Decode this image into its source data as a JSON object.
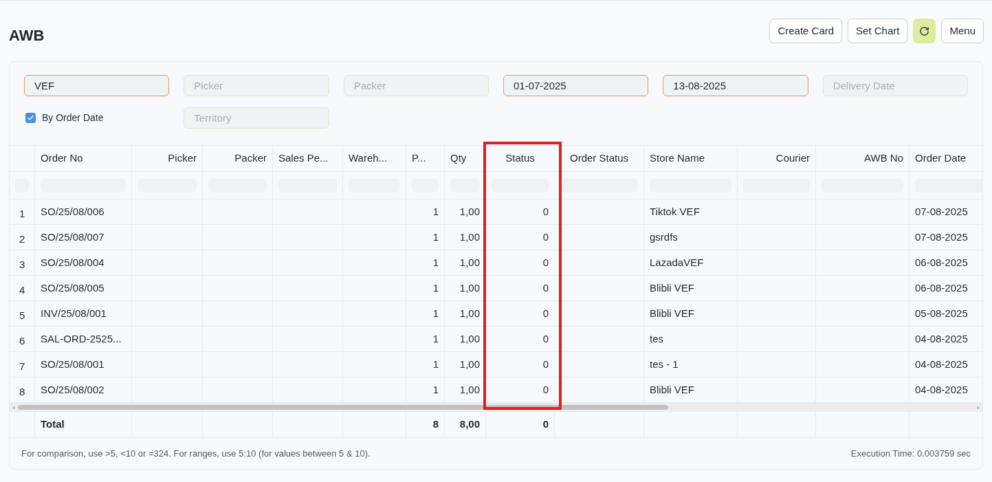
{
  "page": {
    "title": "AWB"
  },
  "actions": [
    {
      "kind": "text",
      "label": "Create Card"
    },
    {
      "kind": "text",
      "label": "Set Chart"
    },
    {
      "kind": "refresh"
    },
    {
      "kind": "text",
      "label": "Menu"
    }
  ],
  "filters": [
    {
      "value": "VEF"
    },
    {
      "placeholder": "Picker"
    },
    {
      "placeholder": "Packer"
    },
    {
      "value": "01-07-2025"
    },
    {
      "value": "13-08-2025"
    },
    {
      "placeholder": "Delivery Date"
    }
  ],
  "by_order_date": {
    "label": "By Order Date",
    "checked": true
  },
  "territory": {
    "placeholder": "Territory"
  },
  "table": {
    "columns": [
      {
        "label": "Order No",
        "highlighted": false
      },
      {
        "label": "Picker",
        "highlighted": false
      },
      {
        "label": "Packer",
        "highlighted": false
      },
      {
        "label": "Sales Pe...",
        "highlighted": false
      },
      {
        "label": "Wareh...",
        "highlighted": false
      },
      {
        "label": "P...",
        "highlighted": false
      },
      {
        "label": "Qty",
        "highlighted": false
      },
      {
        "label": "Status",
        "highlighted": true
      },
      {
        "label": "Order Status",
        "highlighted": false
      },
      {
        "label": "Store Name",
        "highlighted": false
      },
      {
        "label": "Courier",
        "highlighted": false
      },
      {
        "label": "AWB No",
        "highlighted": false
      },
      {
        "label": "Order Date",
        "highlighted": false
      }
    ],
    "rows": [
      {
        "number": "1",
        "order_no": "SO/25/08/006",
        "p": "1",
        "qty": "1,00",
        "status": "0",
        "store_name": "Tiktok VEF",
        "order_date": "07-08-2025"
      },
      {
        "number": "2",
        "order_no": "SO/25/08/007",
        "p": "1",
        "qty": "1,00",
        "status": "0",
        "store_name": "gsrdfs",
        "order_date": "07-08-2025"
      },
      {
        "number": "3",
        "order_no": "SO/25/08/004",
        "p": "1",
        "qty": "1,00",
        "status": "0",
        "store_name": "LazadaVEF",
        "order_date": "06-08-2025"
      },
      {
        "number": "4",
        "order_no": "SO/25/08/005",
        "p": "1",
        "qty": "1,00",
        "status": "0",
        "store_name": "Blibli VEF",
        "order_date": "06-08-2025"
      },
      {
        "number": "5",
        "order_no": "INV/25/08/001",
        "p": "1",
        "qty": "1,00",
        "status": "0",
        "store_name": "Blibli VEF",
        "order_date": "05-08-2025"
      },
      {
        "number": "6",
        "order_no": "SAL-ORD-2525...",
        "p": "1",
        "qty": "1,00",
        "status": "0",
        "store_name": "tes",
        "order_date": "04-08-2025"
      },
      {
        "number": "7",
        "order_no": "SO/25/08/001",
        "p": "1",
        "qty": "1,00",
        "status": "0",
        "store_name": "tes - 1",
        "order_date": "04-08-2025"
      },
      {
        "number": "8",
        "order_no": "SO/25/08/002",
        "p": "1",
        "qty": "1,00",
        "status": "0",
        "store_name": "Blibli VEF",
        "order_date": "04-08-2025"
      }
    ],
    "total": {
      "order_no": "Total",
      "p": "8",
      "qty": "8,00",
      "status": "0"
    }
  },
  "footer": {
    "hint": "For comparison, use >5, <10 or =324. For ranges, use 5:10 (for values between 5 & 10).",
    "execution_time": "Execution Time: 0.003759 sec"
  }
}
